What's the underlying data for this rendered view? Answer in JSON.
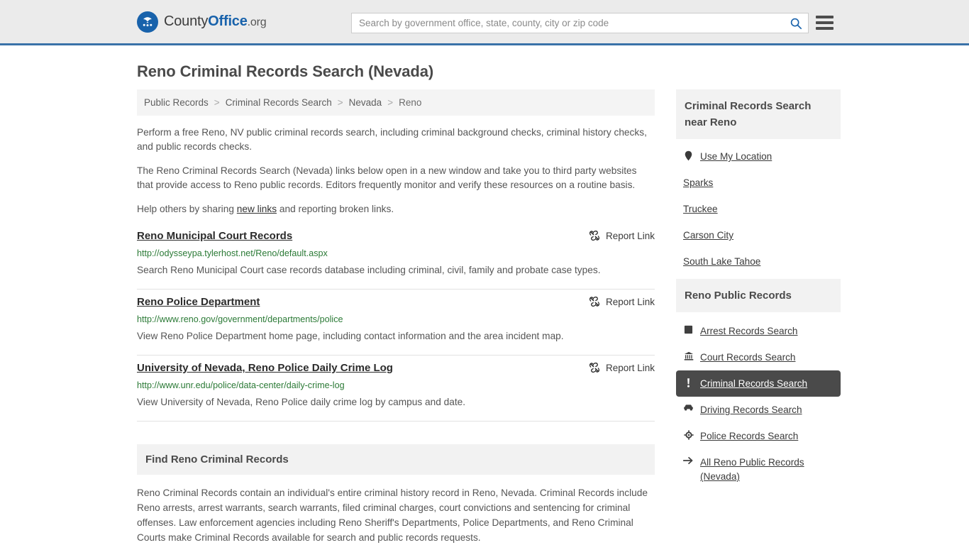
{
  "header": {
    "brand": {
      "part1": "County",
      "part2": "Office",
      "part3": ".org",
      "logo_icon": "eagle-shield-logo"
    },
    "search": {
      "placeholder": "Search by government office, state, county, city or zip code",
      "value": "",
      "icon": "search-icon"
    },
    "menu_icon": "hamburger-menu-icon",
    "accent_color": "#3a72a8",
    "background_color": "#ebebeb"
  },
  "page": {
    "title": "Reno Criminal Records Search (Nevada)"
  },
  "breadcrumb": {
    "separator": ">",
    "items": [
      {
        "label": "Public Records"
      },
      {
        "label": "Criminal Records Search"
      },
      {
        "label": "Nevada"
      },
      {
        "label": "Reno"
      }
    ]
  },
  "intro": {
    "paragraph_1": "Perform a free Reno, NV public criminal records search, including criminal background checks, criminal history checks, and public records checks.",
    "paragraph_2": "The Reno Criminal Records Search (Nevada) links below open in a new window and take you to third party websites that provide access to Reno public records. Editors frequently monitor and verify these resources on a routine basis.",
    "paragraph_3_before": "Help others by sharing ",
    "paragraph_3_link": "new links",
    "paragraph_3_after": " and reporting broken links."
  },
  "results": {
    "report_label": "Report Link",
    "report_icon": "broken-link-icon",
    "items": [
      {
        "title": "Reno Municipal Court Records",
        "url": "http://odysseypa.tylerhost.net/Reno/default.aspx",
        "description": "Search Reno Municipal Court case records database including criminal, civil, family and probate case types."
      },
      {
        "title": "Reno Police Department",
        "url": "http://www.reno.gov/government/departments/police",
        "description": "View Reno Police Department home page, including contact information and the area incident map."
      },
      {
        "title": "University of Nevada, Reno Police Daily Crime Log",
        "url": "http://www.unr.edu/police/data-center/daily-crime-log",
        "description": "View University of Nevada, Reno Police daily crime log by campus and date."
      }
    ]
  },
  "find_section": {
    "heading": "Find Reno Criminal Records",
    "body": "Reno Criminal Records contain an individual's entire criminal history record in Reno, Nevada. Criminal Records include Reno arrests, arrest warrants, search warrants, filed criminal charges, court convictions and sentencing for criminal offenses. Law enforcement agencies including Reno Sheriff's Departments, Police Departments, and Reno Criminal Courts make Criminal Records available for search and public records requests."
  },
  "sidebar": {
    "nearby": {
      "heading": "Criminal Records Search near Reno",
      "items": [
        {
          "label": "Use My Location",
          "icon": "map-pin-icon",
          "has_icon": true
        },
        {
          "label": "Sparks",
          "icon": "",
          "has_icon": false
        },
        {
          "label": "Truckee",
          "icon": "",
          "has_icon": false
        },
        {
          "label": "Carson City",
          "icon": "",
          "has_icon": false
        },
        {
          "label": "South Lake Tahoe",
          "icon": "",
          "has_icon": false
        }
      ]
    },
    "public_records": {
      "heading": "Reno Public Records",
      "active_background": "#4a4a4a",
      "items": [
        {
          "label": "Arrest Records Search",
          "icon": "fingerprint-square-icon",
          "active": false
        },
        {
          "label": "Court Records Search",
          "icon": "courthouse-icon",
          "active": false
        },
        {
          "label": "Criminal Records Search",
          "icon": "exclamation-mark-icon",
          "active": true
        },
        {
          "label": "Driving Records Search",
          "icon": "car-icon",
          "active": false
        },
        {
          "label": "Police Records Search",
          "icon": "police-badge-icon",
          "active": false
        },
        {
          "label": "All Reno Public Records (Nevada)",
          "icon": "arrow-right-icon",
          "active": false
        }
      ]
    }
  }
}
